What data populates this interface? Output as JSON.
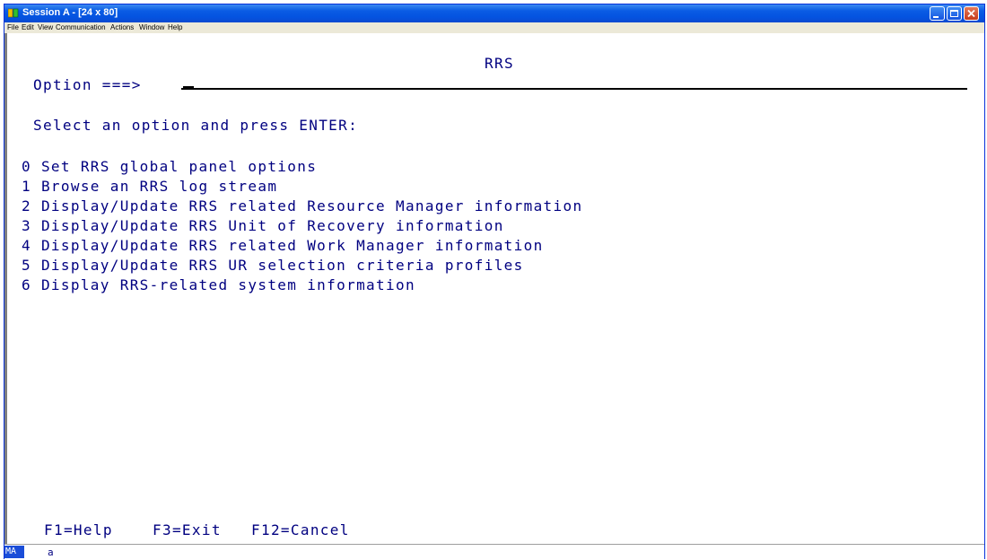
{
  "window": {
    "title": "Session A - [24 x 80]"
  },
  "menubar": {
    "items": [
      "File",
      "Edit",
      "View",
      "Communication",
      "Actions",
      "Window",
      "Help"
    ]
  },
  "panel": {
    "title": "RRS",
    "command_label": "Option ===>",
    "instruction": "Select an option and press ENTER:",
    "options": [
      "0 Set RRS global panel options",
      "1 Browse an RRS log stream",
      "2 Display/Update RRS related Resource Manager information",
      "3 Display/Update RRS Unit of Recovery information",
      "4 Display/Update RRS related Work Manager information",
      "5 Display/Update RRS UR selection criteria profiles",
      "6 Display RRS-related system information"
    ],
    "pf_keys": [
      "F1=Help",
      "F3=Exit",
      "F12=Cancel"
    ]
  },
  "statusbar": {
    "mode": "MA",
    "indicator": "a"
  },
  "colors": {
    "terminal_text": "#000080",
    "titlebar": "#0a5ce4",
    "status_highlight": "#1a4dd8"
  },
  "icons": {
    "app": "session-terminal-icon",
    "minimize": "minimize-icon",
    "maximize": "maximize-icon",
    "close": "close-icon"
  }
}
